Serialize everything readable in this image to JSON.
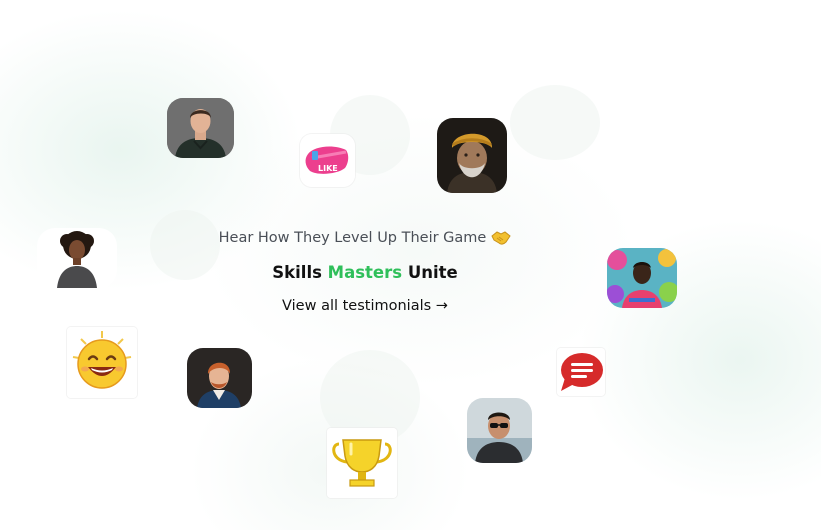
{
  "section": {
    "eyebrow": "Hear How They Level Up Their Game",
    "eyebrow_icon": "handshake-emoji",
    "heading_before": "Skills ",
    "heading_accent": "Masters",
    "heading_after": " Unite",
    "cta_label": "View all testimonials",
    "cta_arrow": "→",
    "accent_color": "#2fbf5a"
  },
  "decor": {
    "like_sticker_text": "LIKE"
  },
  "avatars": [
    "man-dark-sweater-avatar",
    "elderly-man-turban-avatar",
    "woman-curly-hair-avatar",
    "man-colorful-wall-avatar",
    "man-red-hair-avatar",
    "man-sunglasses-avatar"
  ],
  "icons": [
    "like-sticker-icon",
    "laughing-emoji-icon",
    "chat-bubble-icon",
    "trophy-icon"
  ]
}
